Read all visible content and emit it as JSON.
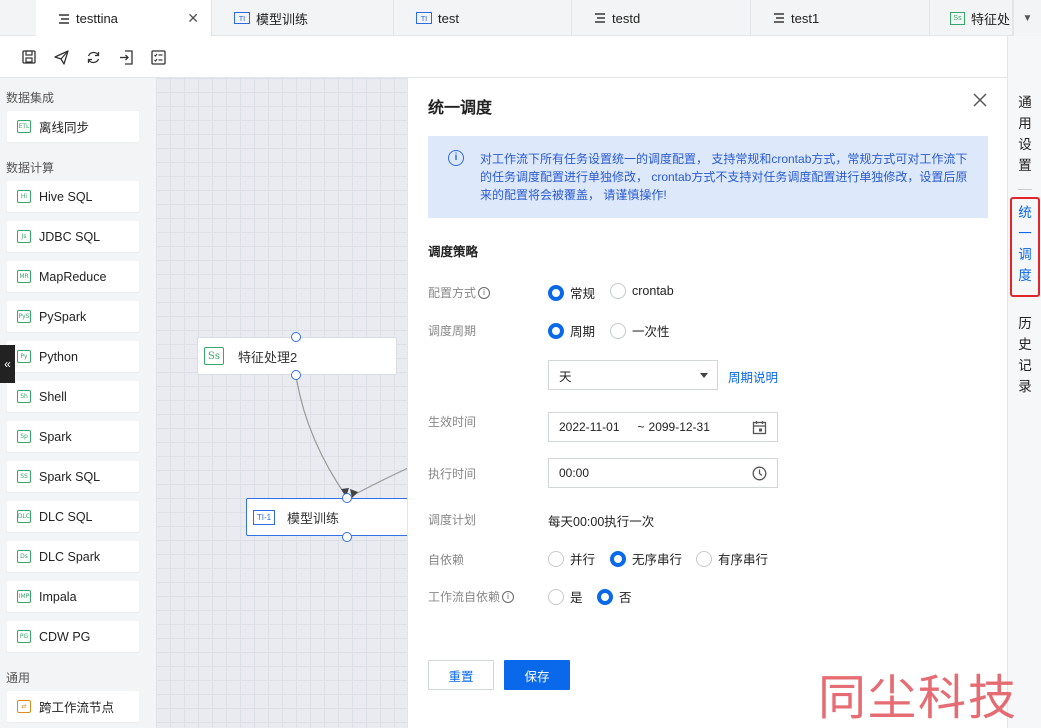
{
  "tabs": [
    {
      "label": "testtina",
      "icon": "workflow-icon",
      "active": true
    },
    {
      "label": "模型训练",
      "icon": "timl-icon"
    },
    {
      "label": "test",
      "icon": "timl-icon"
    },
    {
      "label": "testd",
      "icon": "workflow-icon"
    },
    {
      "label": "test1",
      "icon": "workflow-icon"
    },
    {
      "label": "特征处",
      "icon": "ss-icon"
    }
  ],
  "sidebar": {
    "sections": [
      {
        "title": "数据集成",
        "items": [
          {
            "label": "离线同步",
            "icon": "ETL"
          }
        ]
      },
      {
        "title": "数据计算",
        "items": [
          {
            "label": "Hive SQL",
            "icon": "Hi"
          },
          {
            "label": "JDBC SQL",
            "icon": "Js"
          },
          {
            "label": "MapReduce",
            "icon": "MR"
          },
          {
            "label": "PySpark",
            "icon": "PyS"
          },
          {
            "label": "Python",
            "icon": "Py"
          },
          {
            "label": "Shell",
            "icon": "Sh"
          },
          {
            "label": "Spark",
            "icon": "Sp"
          },
          {
            "label": "Spark SQL",
            "icon": "SS"
          },
          {
            "label": "DLC SQL",
            "icon": "DLC"
          },
          {
            "label": "DLC Spark",
            "icon": "Ds"
          },
          {
            "label": "Impala",
            "icon": "IMP"
          },
          {
            "label": "CDW PG",
            "icon": "PG"
          }
        ]
      },
      {
        "title": "通用",
        "items": [
          {
            "label": "跨工作流节点",
            "icon": "cross-icon"
          }
        ]
      }
    ],
    "collapse_glyph": "«"
  },
  "canvas": {
    "nodes": [
      {
        "label": "特征处理2",
        "icon": "Ss"
      },
      {
        "label": "模型训练",
        "icon": "TI-1"
      }
    ]
  },
  "dialog": {
    "title": "统一调度",
    "info_text": "对工作流下所有任务设置统一的调度配置， 支持常规和crontab方式，常规方式可对工作流下的任务调度配置进行单独修改， crontab方式不支持对任务调度配置进行单独修改，设置后原来的配置将会被覆盖， 请谨慎操作!",
    "section_title": "调度策略",
    "config_mode": {
      "label": "配置方式",
      "options": [
        "常规",
        "crontab"
      ],
      "selected": "常规"
    },
    "schedule_cycle": {
      "label": "调度周期",
      "options": [
        "周期",
        "一次性"
      ],
      "selected": "周期"
    },
    "cycle_unit": {
      "value": "天",
      "help_link": "周期说明"
    },
    "effective_time": {
      "label": "生效时间",
      "start": "2022-11-01",
      "separator": "~",
      "end": "2099-12-31"
    },
    "exec_time": {
      "label": "执行时间",
      "value": "00:00"
    },
    "schedule_plan": {
      "label": "调度计划",
      "value": "每天00:00执行一次"
    },
    "self_dependency": {
      "label": "自依赖",
      "options": [
        "并行",
        "无序串行",
        "有序串行"
      ],
      "selected": "无序串行"
    },
    "workflow_self_dependency": {
      "label": "工作流自依赖",
      "options": [
        "是",
        "否"
      ],
      "selected": "否"
    },
    "buttons": {
      "reset": "重置",
      "save": "保存"
    }
  },
  "rail": {
    "items": [
      "通用设置",
      "统一调度",
      "历史记录"
    ],
    "active": "统一调度"
  },
  "watermark": "同尘科技",
  "colors": {
    "accent": "#0a68ea",
    "highlight": "#e0262b",
    "info_bg": "#dde9fb"
  }
}
